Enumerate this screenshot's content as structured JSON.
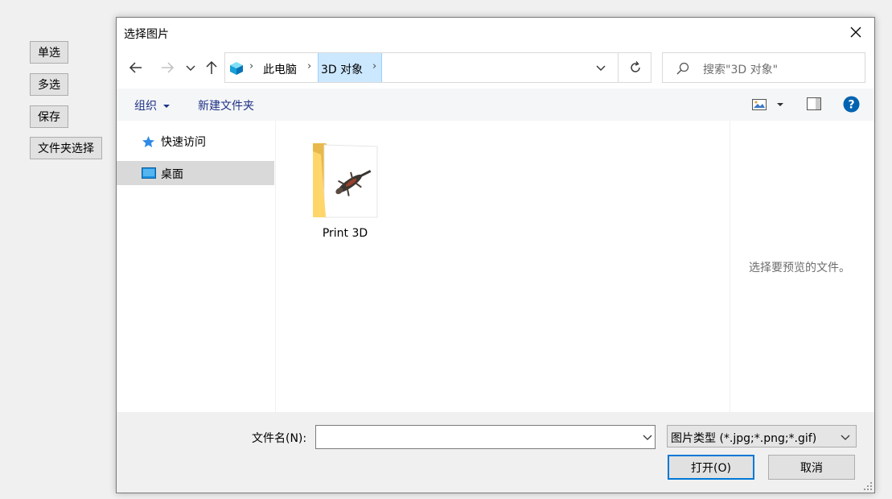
{
  "side_buttons": [
    {
      "label": "单选"
    },
    {
      "label": "多选"
    },
    {
      "label": "保存"
    },
    {
      "label": "文件夹选择"
    }
  ],
  "dialog": {
    "title": "选择图片",
    "breadcrumb": [
      "此电脑",
      "3D 对象"
    ],
    "search_placeholder": "搜索\"3D 对象\"",
    "toolbar": {
      "organize": "组织",
      "new_folder": "新建文件夹"
    },
    "nav": [
      {
        "label": "快速访问",
        "icon": "quick-access-star-icon"
      },
      {
        "label": "桌面",
        "icon": "desktop-icon",
        "selected": true
      }
    ],
    "files": [
      {
        "name": "Print 3D",
        "icon": "folder-icon"
      }
    ],
    "preview_hint": "选择要预览的文件。",
    "filename_label": "文件名(N):",
    "filename_value": "",
    "filetype": "图片类型 (*.jpg;*.png;*.gif)",
    "open_button": "打开(O)",
    "cancel_button": "取消"
  },
  "colors": {
    "accent": "#0078d7",
    "selection": "#cce8ff",
    "toolbar_text": "#1e3287"
  }
}
